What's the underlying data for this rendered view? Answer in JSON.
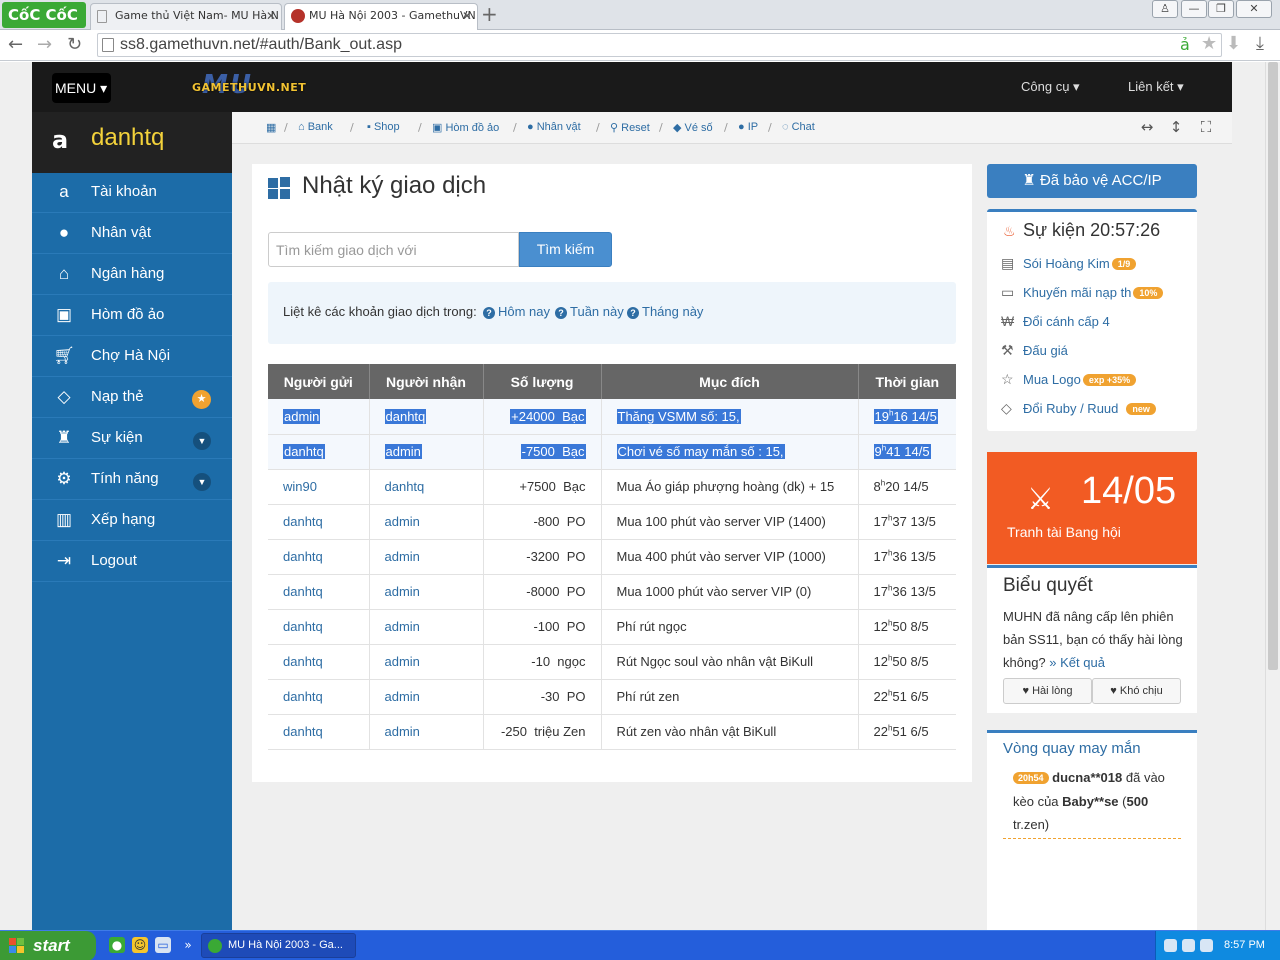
{
  "browser": {
    "brand": "CốC CốC",
    "tabs": [
      {
        "title": "Game thủ Việt Nam- MU Hà N",
        "active": false
      },
      {
        "title": "MU Hà Nội 2003 - GamethuVN",
        "active": true
      }
    ],
    "url": "ss8.gamethuvn.net/#auth/Bank_out.asp"
  },
  "topnav": {
    "menu_label": "MENU",
    "logo_text": "GAMETHUVN.NET",
    "logo_mark": "MU",
    "tools_label": "Công cụ",
    "links_label": "Liên kết"
  },
  "sidebar": {
    "username": "danhtq",
    "items": [
      {
        "label": "Tài khoản",
        "icon": "amazon-icon"
      },
      {
        "label": "Nhân vật",
        "icon": "user-icon"
      },
      {
        "label": "Ngân hàng",
        "icon": "bank-icon"
      },
      {
        "label": "Hòm đồ ảo",
        "icon": "briefcase-icon"
      },
      {
        "label": "Chợ Hà Nội",
        "icon": "cart-icon"
      },
      {
        "label": "Nạp thẻ",
        "icon": "diamond-icon"
      },
      {
        "label": "Sự kiện",
        "icon": "android-icon"
      },
      {
        "label": "Tính năng",
        "icon": "cogs-icon"
      },
      {
        "label": "Xếp hạng",
        "icon": "bar-chart-icon"
      },
      {
        "label": "Logout",
        "icon": "sign-out-icon"
      }
    ]
  },
  "breadcrumb": {
    "items": [
      "Bank",
      "Shop",
      "Hòm đồ ảo",
      "Nhân vật",
      "Reset",
      "Vé số",
      "IP",
      "Chat"
    ]
  },
  "main": {
    "title": "Nhật ký giao dịch",
    "search_placeholder": "Tìm kiếm giao dịch với",
    "search_button": "Tìm kiếm",
    "filter_text": "Liệt kê các khoản giao dịch trong:",
    "filter_links": [
      "Hôm nay",
      "Tuần này",
      "Tháng này"
    ],
    "table": {
      "headers": [
        "Người gửi",
        "Người nhận",
        "Số lượng",
        "Mục đích",
        "Thời gian"
      ],
      "rows": [
        {
          "sender": "admin",
          "receiver": "danhtq",
          "amount": "+24000  Bạc",
          "purpose": "Thăng VSMM số: 15,",
          "hour": "19",
          "minute": "16 14/5",
          "selected": true
        },
        {
          "sender": "danhtq",
          "receiver": "admin",
          "amount": "-7500  Bạc",
          "purpose": "Chơi vé số may mắn số : 15,",
          "hour": "9",
          "minute": "41 14/5",
          "selected": true
        },
        {
          "sender": "win90",
          "receiver": "danhtq",
          "amount": "+7500  Bạc",
          "purpose": "Mua Áo giáp phượng hoàng (dk) + 15",
          "hour": "8",
          "minute": "20 14/5",
          "selected": false
        },
        {
          "sender": "danhtq",
          "receiver": "admin",
          "amount": "-800  PO",
          "purpose": "Mua 100 phút vào server VIP (1400)",
          "hour": "17",
          "minute": "37 13/5",
          "selected": false
        },
        {
          "sender": "danhtq",
          "receiver": "admin",
          "amount": "-3200  PO",
          "purpose": "Mua 400 phút vào server VIP (1000)",
          "hour": "17",
          "minute": "36 13/5",
          "selected": false
        },
        {
          "sender": "danhtq",
          "receiver": "admin",
          "amount": "-8000  PO",
          "purpose": "Mua 1000 phút vào server VIP (0)",
          "hour": "17",
          "minute": "36 13/5",
          "selected": false
        },
        {
          "sender": "danhtq",
          "receiver": "admin",
          "amount": "-100  PO",
          "purpose": "Phí rút ngọc",
          "hour": "12",
          "minute": "50 8/5",
          "selected": false
        },
        {
          "sender": "danhtq",
          "receiver": "admin",
          "amount": "-10  ngọc",
          "purpose": "Rút Ngọc soul vào nhân vật BiKull",
          "hour": "12",
          "minute": "50 8/5",
          "selected": false
        },
        {
          "sender": "danhtq",
          "receiver": "admin",
          "amount": "-30  PO",
          "purpose": "Phí rút zen",
          "hour": "22",
          "minute": "51 6/5",
          "selected": false
        },
        {
          "sender": "danhtq",
          "receiver": "admin",
          "amount": "-250  triệu Zen",
          "purpose": "Rút zen vào nhân vật BiKull",
          "hour": "22",
          "minute": "51 6/5",
          "selected": false
        }
      ]
    }
  },
  "right": {
    "protect_label": "Đã bảo vệ ACC/IP",
    "events_title": "Sự kiện 20:57:26",
    "events": [
      {
        "label": "Sói Hoàng Kim",
        "badge": "1/9",
        "icon": "gift-icon"
      },
      {
        "label": "Khuyến mãi nạp th",
        "badge": "10%",
        "icon": "money-icon"
      },
      {
        "label": "Đổi cánh cấp 4",
        "badge": "",
        "icon": "won-icon"
      },
      {
        "label": "Đấu giá",
        "badge": "",
        "icon": "gavel-icon"
      },
      {
        "label": "Mua Logo",
        "badge": "exp +35%",
        "icon": "star-icon"
      },
      {
        "label": "Đổi Ruby / Ruud",
        "badge": "new",
        "icon": "diamond-icon"
      }
    ],
    "war_date": "14/05",
    "war_label": "Tranh tài Bang hội",
    "poll_title": "Biểu quyết",
    "poll_question": "MUHN đã nâng cấp lên phiên bản SS11, bạn có thấy hài lòng không?",
    "poll_result_link": "» Kết quả",
    "poll_yes": "Hài lòng",
    "poll_no": "Khó chịu",
    "wheel_title": "Vòng quay may mắn",
    "wheel_time": "20h54",
    "wheel_user": "ducna**018",
    "wheel_mid": "đã vào kèo của",
    "wheel_target": "Baby**se",
    "wheel_amount": "500",
    "wheel_unit": "tr.zen"
  },
  "taskbar": {
    "start_label": "start",
    "task_item": "MU Hà Nội 2003 - Ga...",
    "clock": "8:57 PM"
  },
  "colors": {
    "sidebar": "#1c6ca8",
    "accent": "#3a7fc0",
    "war_box": "#f25b23",
    "badge": "#f0a230",
    "username": "#f3d23b"
  }
}
